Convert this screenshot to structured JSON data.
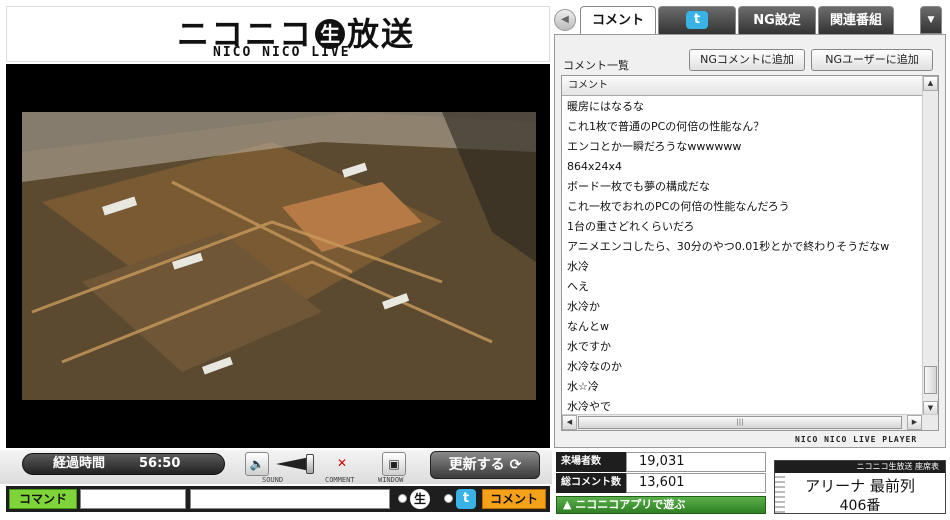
{
  "logo": {
    "main_a": "ニコニコ",
    "nama": "生",
    "main_b": "放送",
    "sub": "NICO NICO LIVE"
  },
  "controls": {
    "elapsed_label": "経過時間",
    "elapsed_time": "56:50",
    "sound_caption": "SOUND",
    "comment_caption": "COMMENT",
    "window_caption": "WINDOW",
    "update_label": "更新する"
  },
  "input_bar": {
    "command_label": "コマンド",
    "command_value": "",
    "comment_value": "",
    "nama_icon": "生",
    "twitter_icon": "t",
    "comment_button": "コメント"
  },
  "tabs": {
    "items": [
      {
        "label": "コメント",
        "active": true
      },
      {
        "label": "",
        "icon": "twitter-icon",
        "active": false
      },
      {
        "label": "NG設定",
        "active": false
      },
      {
        "label": "関連番組",
        "active": false
      }
    ]
  },
  "panel": {
    "list_title": "コメント一覧",
    "ng_comment_button": "NGコメントに追加",
    "ng_user_button": "NGユーザーに追加",
    "column_header": "コメント",
    "comments": [
      "暖房にはなるな",
      "これ1枚で普通のPCの何倍の性能なん？",
      "エンコとか一瞬だろうなwwwwww",
      "864x24x4",
      "ボード一枚でも夢の構成だな",
      "これ一枚でおれのPCの何倍の性能なんだろう",
      "1台の重さどれくらいだろ",
      "アニメエンコしたら、30分のやつ0.01秒とかで終わりそうだなw",
      "水冷",
      "へえ",
      "水冷か",
      "なんとw",
      "水ですか",
      "水冷なのか",
      "水☆冷",
      "水冷やで"
    ],
    "brand": "NICO NICO LIVE PLAYER"
  },
  "stats": {
    "visitors_label": "来場者数",
    "visitors_value": "19,031",
    "comments_label": "総コメント数",
    "comments_value": "13,601",
    "app_link": "ニコニコアプリで遊ぶ"
  },
  "ticket": {
    "header": "ニコニコ生放送 座席表",
    "seat": "アリーナ 最前列",
    "number": "406番"
  }
}
